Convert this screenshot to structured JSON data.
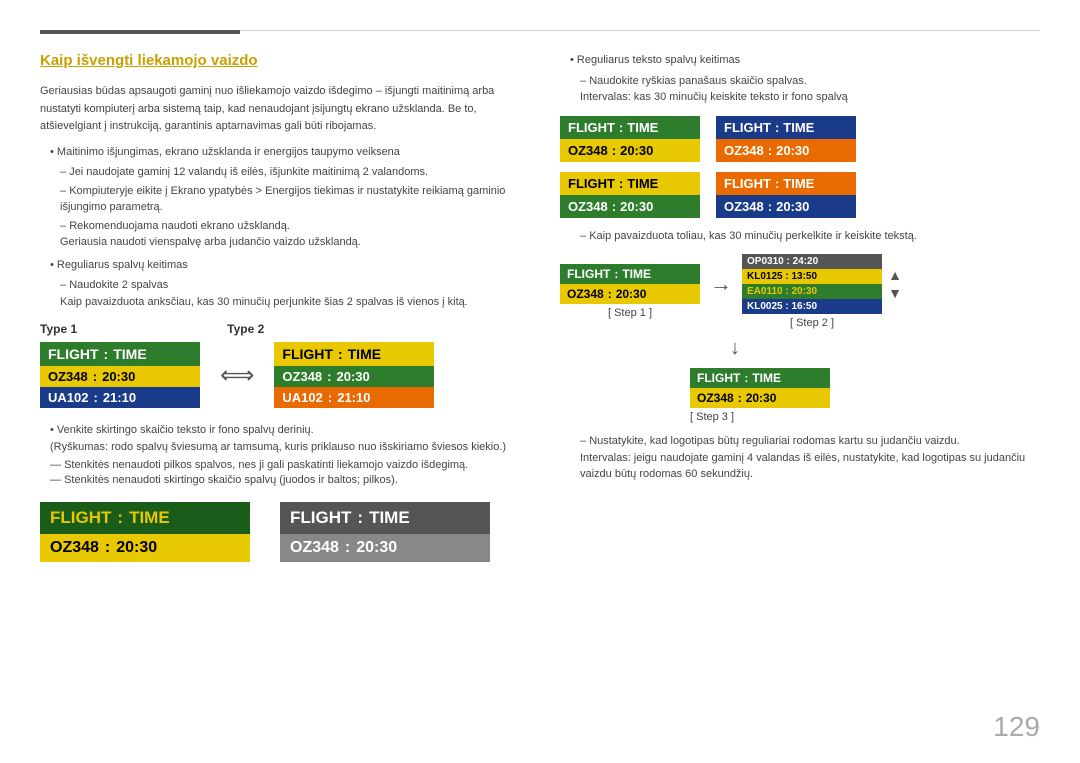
{
  "page": {
    "number": "129",
    "top_line_width": 200
  },
  "section": {
    "title": "Kaip išvengti liekamojo vaizdo",
    "intro": "Geriausias būdas apsaugoti gaminį nuo išliekamojo vaizdo išdegimo – išjungti maitinimą arba nustatyti kompiuterį arba sistemą taip, kad nenaudojant įsijungtų ekrano užsklanda. Be to, atšievelgiant į instrukciją, garantinis aptarnavimas gali būti ribojamas.",
    "bullets": [
      {
        "text": "Maitinimo išjungimas, ekrano užsklanda ir energijos taupymo veiksena",
        "dashes": [
          "Jei naudojate gaminį 12 valandų iš eilės, išjunkite maitinimą 2 valandoms.",
          "Kompiuteryje eikite į Ekrano ypatybės > Energijos tiekimas ir nustatykite reikiamą gaminio išjungimo parametrą.",
          "Rekomenduojama naudoti ekrano užsklandą.\nGeriausia naudoti vienspalvę arba judančio vaizdo užsklandą."
        ]
      },
      {
        "text": "Reguliarus spalvų keitimas",
        "dashes": [
          "Naudokite 2 spalvas\nKaip pavaizduota anksčiau, kas 30 minučių perjunkite šias 2 spalvas iš vienos į kitą."
        ]
      }
    ],
    "type_labels": [
      "Type 1",
      "Type 2"
    ],
    "board1": {
      "header_left": "FLIGHT",
      "header_right": "TIME",
      "row1_left": "OZ348",
      "row1_right": "20:30",
      "row2_left": "UA102",
      "row2_right": "21:10"
    },
    "bottom_bullets": [
      "Venkite skirtingo skaičio teksto ir fono spalvų derinių.\n(Ryškumas: rodo spalvų šviesumą ar tamsumą, kuris priklauso nuo išskiriamo šviesos kiekio.)",
      "Stenkitės nenaudoti pilkos spalvos, nes ji gali paskatinti liekamojo vaizdo išdegimą.",
      "Stenkitės nenaudoti skirtingo skaičio spalvų (juodos ir baltos; pilkos)."
    ],
    "bottom_boards": [
      {
        "header_left": "FLIGHT",
        "header_right": "TIME",
        "row_left": "OZ348",
        "row_right": "20:30",
        "style": "dark_green_yellow"
      },
      {
        "header_left": "FLIGHT",
        "header_right": "TIME",
        "row_left": "OZ348",
        "row_right": "20:30",
        "style": "dark_gray"
      }
    ]
  },
  "right_section": {
    "bullets": [
      {
        "text": "Reguliarus teksto spalvų keitimas",
        "dashes": [
          "Naudokite ryškias panašaus skaičio spalvas.\nIntervalas: kas 30 minučių keiskite teksto ir fono spalvą"
        ]
      }
    ],
    "boards_row1": [
      {
        "header_left": "FLIGHT",
        "header_right": "TIME",
        "row_left": "OZ348",
        "row_right": "20:30",
        "header_bg": "#2d7d2d",
        "row_bg": "#e8c800",
        "header_color": "#fff",
        "row_color": "#000"
      },
      {
        "header_left": "FLIGHT",
        "header_right": "TIME",
        "row_left": "OZ348",
        "row_right": "20:30",
        "header_bg": "#1a3a8a",
        "row_bg": "#e86a00",
        "header_color": "#fff",
        "row_color": "#fff"
      }
    ],
    "boards_row2": [
      {
        "header_left": "FLIGHT",
        "header_right": "TIME",
        "row_left": "OZ348",
        "row_right": "20:30",
        "header_bg": "#e8c800",
        "row_bg": "#2d7d2d",
        "header_color": "#000",
        "row_color": "#fff"
      },
      {
        "header_left": "FLIGHT",
        "header_right": "TIME",
        "row_left": "OZ348",
        "row_right": "20:30",
        "header_bg": "#e86a00",
        "row_bg": "#1a3a8a",
        "header_color": "#fff",
        "row_color": "#fff"
      }
    ],
    "step_note": "– Kaip pavaizduota toliau, kas 30 minučių perkelkite ir keiskite tekstą.",
    "steps": {
      "step1_label": "[ Step 1 ]",
      "step2_label": "[ Step 2 ]",
      "step3_label": "[ Step 3 ]",
      "step1_board": {
        "header_left": "FLIGHT",
        "header_right": "TIME",
        "row_left": "OZ348",
        "row_right": "20:30"
      },
      "step3_board": {
        "header_left": "FLIGHT",
        "header_right": "TIME",
        "row_left": "OZ348",
        "row_right": "20:30"
      }
    },
    "bottom_note": "– Nustatykite, kad logotipas būtų reguliariai rodomas kartu su judančiu vaizdu.\nIntervalas: jeigu naudojate gaminį 4 valandas iš eilės, nustatykite, kad logotipas su judančiu vaizdu būtų rodomas 60 sekundžių."
  }
}
